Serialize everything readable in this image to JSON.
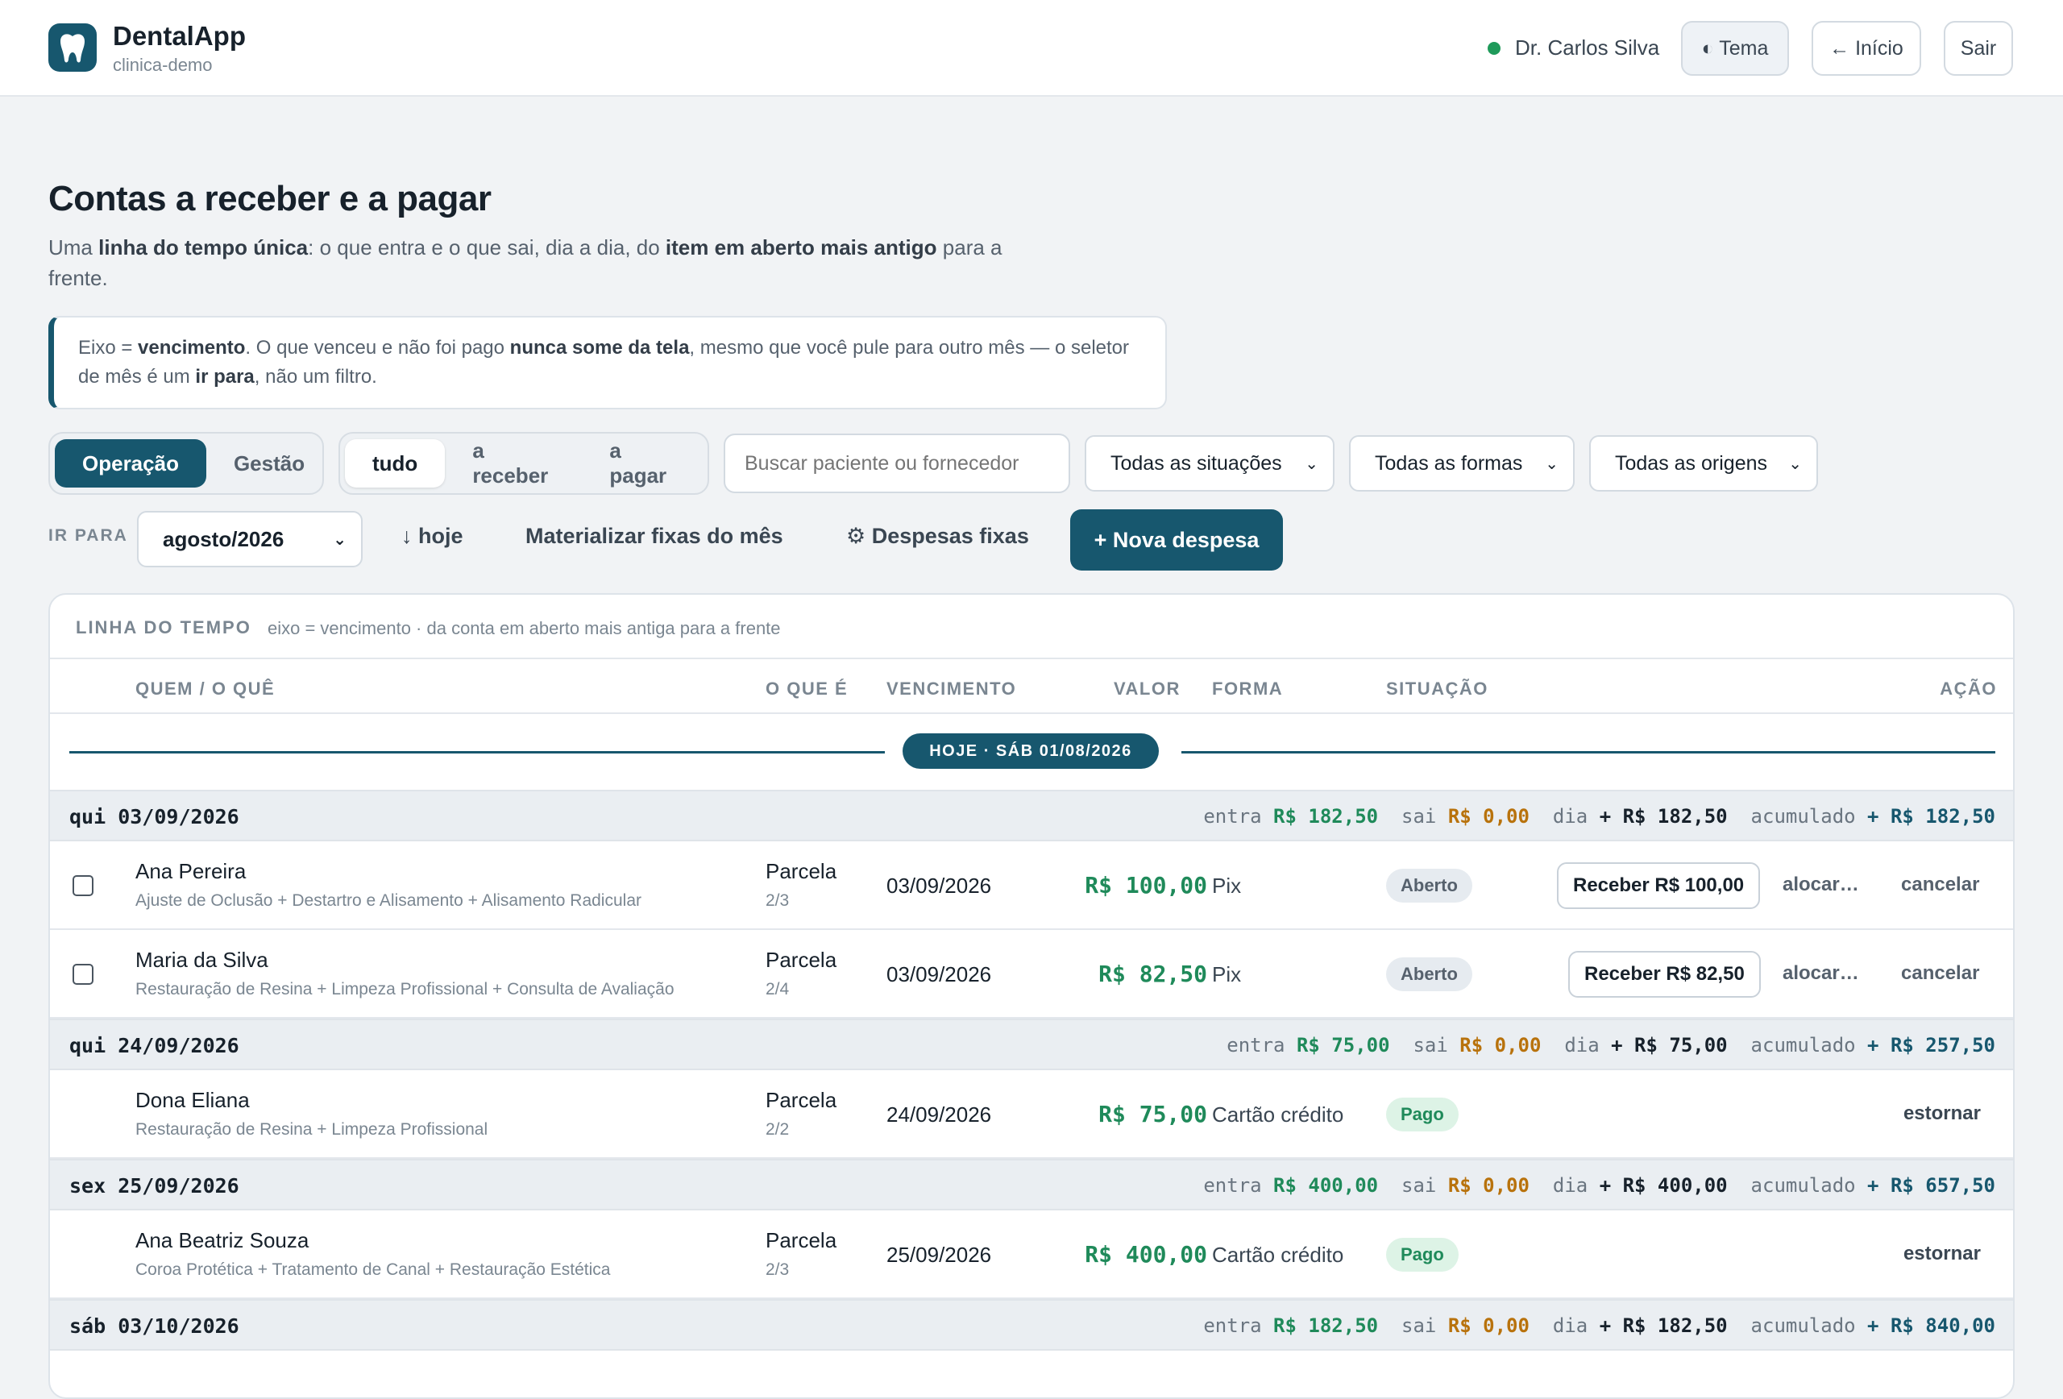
{
  "app": {
    "name": "DentalApp",
    "tenant": "clinica-demo"
  },
  "header": {
    "user": "Dr. Carlos Silva",
    "theme_btn": "◐ Tema",
    "home_btn": "← Início",
    "logout_btn": "Sair"
  },
  "page": {
    "title": "Contas a receber e a pagar",
    "desc_1": "Uma ",
    "desc_b1": "linha do tempo única",
    "desc_2": ": o que entra e o que sai, dia a dia, do ",
    "desc_b2": "item em aberto mais antigo",
    "desc_3": " para a frente.",
    "note_1": "Eixo = ",
    "note_b1": "vencimento",
    "note_2": ". O que venceu e não foi pago ",
    "note_b2": "nunca some da tela",
    "note_3": ", mesmo que você pule para outro mês — o seletor de mês é um ",
    "note_b3": "ir para",
    "note_4": ", não um filtro."
  },
  "filters": {
    "mode": [
      "Operação",
      "Gestão"
    ],
    "flow": [
      "tudo",
      "a receber",
      "a pagar"
    ],
    "search_placeholder": "Buscar paciente ou fornecedor",
    "situacao": "Todas as situações",
    "formas": "Todas as formas",
    "origens": "Todas as origens"
  },
  "nav": {
    "ir_para": "IR PARA",
    "month": "agosto/2026",
    "hoje": "↓ hoje",
    "materializar": "Materializar fixas do mês",
    "despesas_fixas": "⚙ Despesas fixas",
    "nova_despesa": "+ Nova despesa"
  },
  "timeline": {
    "label": "LINHA DO TEMPO",
    "sub": "eixo = vencimento · da conta em aberto mais antiga para a frente",
    "columns": [
      "QUEM / O QUÊ",
      "O QUE É",
      "VENCIMENTO",
      "VALOR",
      "FORMA",
      "SITUAÇÃO",
      "AÇÃO"
    ],
    "today": "HOJE · SÁB 01/08/2026",
    "sum_labels": {
      "entra": "entra",
      "sai": "sai",
      "dia": "dia",
      "acumulado": "acumulado"
    },
    "days": [
      {
        "date": "qui 03/09/2026",
        "entra": "R$ 182,50",
        "sai": "R$ 0,00",
        "dia": "+ R$ 182,50",
        "acumulado": "+ R$ 182,50"
      },
      {
        "date": "qui 24/09/2026",
        "entra": "R$ 75,00",
        "sai": "R$ 0,00",
        "dia": "+ R$ 75,00",
        "acumulado": "+ R$ 257,50"
      },
      {
        "date": "sex 25/09/2026",
        "entra": "R$ 400,00",
        "sai": "R$ 0,00",
        "dia": "+ R$ 400,00",
        "acumulado": "+ R$ 657,50"
      },
      {
        "date": "sáb 03/10/2026",
        "entra": "R$ 182,50",
        "sai": "R$ 0,00",
        "dia": "+ R$ 182,50",
        "acumulado": "+ R$ 840,00"
      }
    ],
    "rows": [
      {
        "name": "Ana Pereira",
        "desc": "Ajuste de Oclusão + Destartro e Alisamento + Alisamento Radicular",
        "kind": "Parcela",
        "parcel": "2/3",
        "due": "03/09/2026",
        "value": "R$ 100,00",
        "forma": "Pix",
        "status": "Aberto",
        "action": "Receber R$ 100,00",
        "alocar": "alocar…",
        "cancelar": "cancelar"
      },
      {
        "name": "Maria da Silva",
        "desc": "Restauração de Resina + Limpeza Profissional + Consulta de Avaliação",
        "kind": "Parcela",
        "parcel": "2/4",
        "due": "03/09/2026",
        "value": "R$ 82,50",
        "forma": "Pix",
        "status": "Aberto",
        "action": "Receber R$ 82,50",
        "alocar": "alocar…",
        "cancelar": "cancelar"
      },
      {
        "name": "Dona Eliana",
        "desc": "Restauração de Resina + Limpeza Profissional",
        "kind": "Parcela",
        "parcel": "2/2",
        "due": "24/09/2026",
        "value": "R$ 75,00",
        "forma": "Cartão crédito",
        "status": "Pago",
        "action": "estornar"
      },
      {
        "name": "Ana Beatriz Souza",
        "desc": "Coroa Protética + Tratamento de Canal + Restauração Estética",
        "kind": "Parcela",
        "parcel": "2/3",
        "due": "25/09/2026",
        "value": "R$ 400,00",
        "forma": "Cartão crédito",
        "status": "Pago",
        "action": "estornar"
      }
    ]
  },
  "colors": {
    "primary": "#17576e",
    "income": "#1f8a5a",
    "expense": "#b8720c",
    "online": "#1f9a5a"
  }
}
